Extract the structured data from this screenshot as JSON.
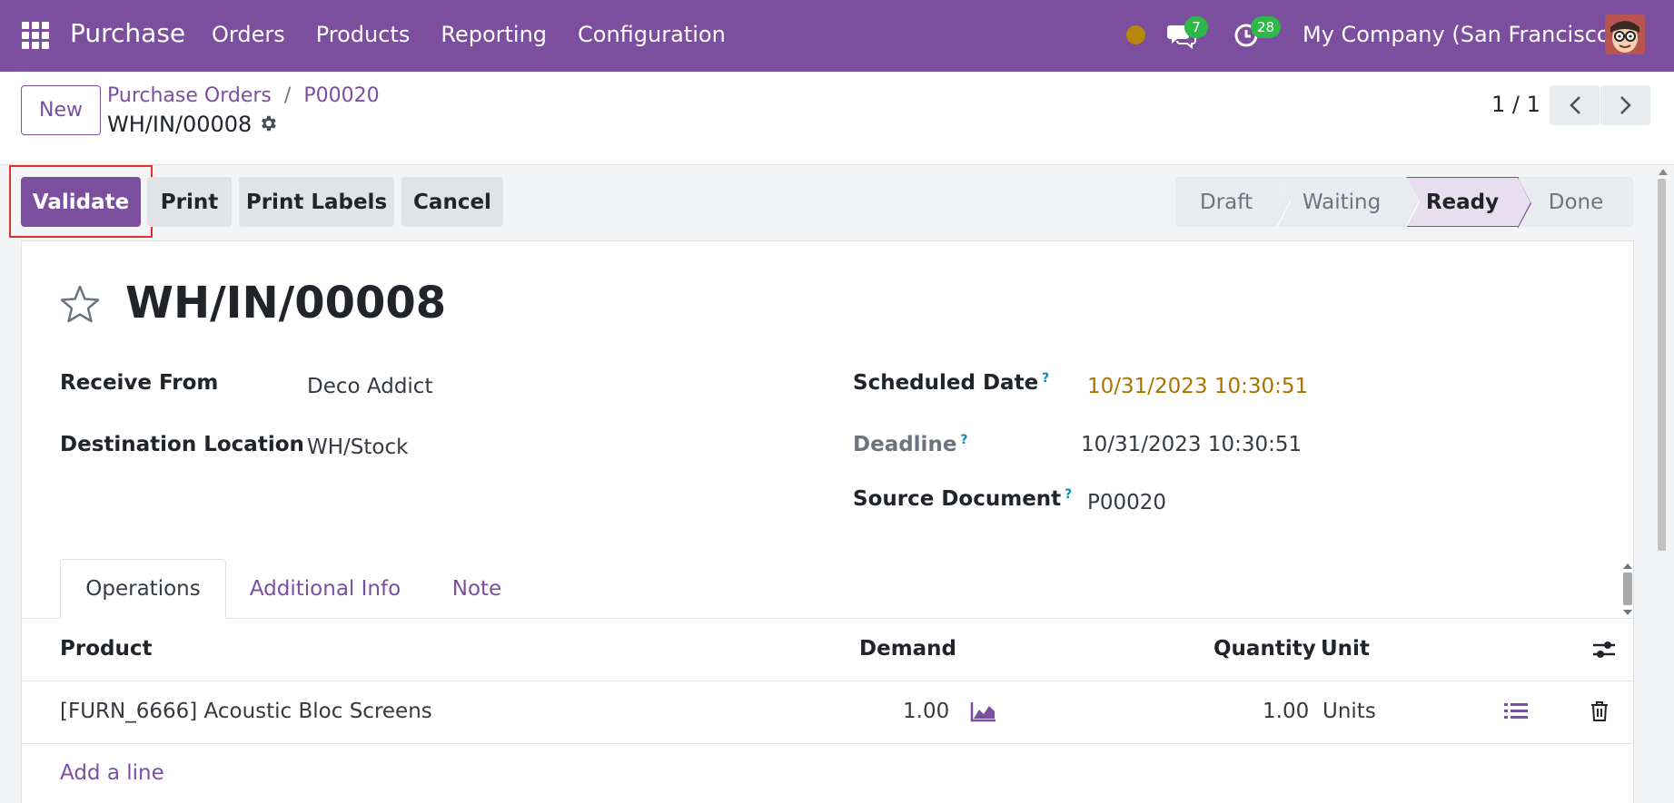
{
  "navbar": {
    "brand": "Purchase",
    "menu": [
      "Orders",
      "Products",
      "Reporting",
      "Configuration"
    ],
    "chat_count": "7",
    "activity_count": "28",
    "company": "My Company (San Francisco)"
  },
  "control": {
    "new_label": "New",
    "breadcrumb": [
      "Purchase Orders",
      "P00020"
    ],
    "breadcrumb_sep": "/",
    "record_name": "WH/IN/00008",
    "pager": "1 / 1"
  },
  "actions": {
    "validate": "Validate",
    "print": "Print",
    "print_labels": "Print Labels",
    "cancel": "Cancel"
  },
  "statusbar": {
    "stages": [
      "Draft",
      "Waiting",
      "Ready",
      "Done"
    ],
    "current": "Ready"
  },
  "form": {
    "title": "WH/IN/00008",
    "receive_from_label": "Receive From",
    "receive_from": "Deco Addict",
    "destination_label": "Destination Location",
    "destination": "WH/Stock",
    "scheduled_date_label": "Scheduled Date",
    "scheduled_date": "10/31/2023 10:30:51",
    "deadline_label": "Deadline",
    "deadline": "10/31/2023 10:30:51",
    "source_document_label": "Source Document",
    "source_document": "P00020",
    "help_mark": "?"
  },
  "tabs": [
    "Operations",
    "Additional Info",
    "Note"
  ],
  "table": {
    "headers": {
      "product": "Product",
      "demand": "Demand",
      "quantity": "Quantity",
      "unit": "Unit"
    },
    "rows": [
      {
        "product": "[FURN_6666] Acoustic Bloc Screens",
        "demand": "1.00",
        "quantity": "1.00",
        "unit": "Units"
      }
    ],
    "add_line": "Add a line"
  },
  "colors": {
    "brand": "#7c4f9e",
    "badge": "#2eb84a",
    "warning_date": "#a87300",
    "highlight_outline": "#e0302f"
  }
}
